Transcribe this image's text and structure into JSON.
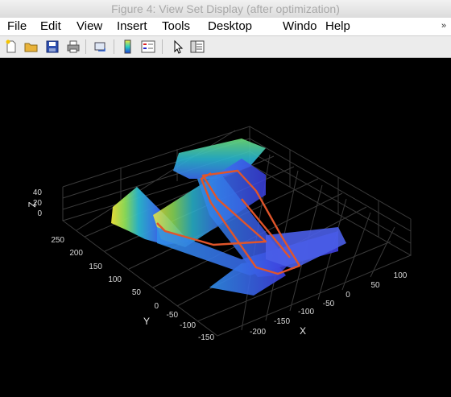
{
  "window": {
    "title": "Figure 4: View Set Display (after optimization)"
  },
  "menu": {
    "items": [
      "File",
      "Edit",
      "View",
      "Insert",
      "Tools",
      "Desktop",
      "Windo",
      "Help"
    ],
    "overflow_icon": "chevron-right-icon"
  },
  "toolbar": {
    "icons": [
      "new-figure-icon",
      "open-file-icon",
      "save-icon",
      "print-icon",
      "link-icon",
      "colorbar-icon",
      "legend-icon",
      "pointer-icon",
      "property-inspector-icon"
    ]
  },
  "axes": {
    "x": {
      "label": "X",
      "ticks": [
        "-200",
        "-150",
        "-100",
        "-50",
        "0",
        "50",
        "100"
      ]
    },
    "y": {
      "label": "Y",
      "ticks": [
        "250",
        "200",
        "150",
        "100",
        "50",
        "0",
        "-50",
        "-100",
        "-150"
      ]
    },
    "z": {
      "label": "Z",
      "ticks": [
        "40",
        "20",
        "0"
      ]
    }
  },
  "colors": {
    "background": "#000000",
    "grid": "#3a3a3a",
    "trajectory": "#e0552a",
    "cloud_low": "#3b52e8",
    "cloud_mid": "#2ab8d0",
    "cloud_high": "#f2e63a"
  }
}
